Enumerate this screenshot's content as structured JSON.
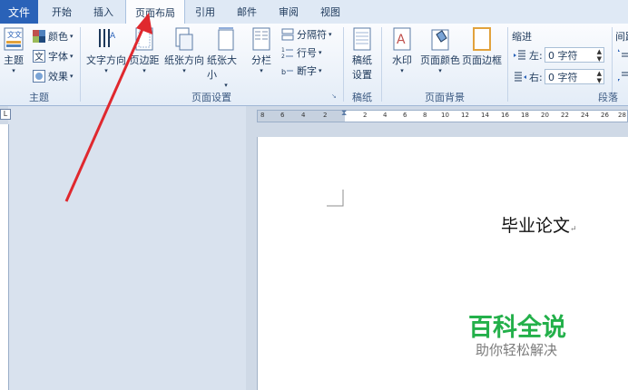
{
  "tabs": {
    "file": "文件",
    "home": "开始",
    "insert": "插入",
    "layout": "页面布局",
    "references": "引用",
    "mailings": "邮件",
    "review": "审阅",
    "view": "视图"
  },
  "theme": {
    "themes": "主题",
    "colors": "颜色",
    "fonts": "字体",
    "effects": "效果",
    "group": "主题"
  },
  "page_setup": {
    "text_direction": "文字方向",
    "margins": "页边距",
    "orientation": "纸张方向",
    "size": "纸张大小",
    "columns": "分栏",
    "breaks": "分隔符",
    "line_numbers": "行号",
    "hyphenation": "断字",
    "group": "页面设置"
  },
  "manuscript": {
    "label_line1": "稿纸",
    "label_line2": "设置",
    "group": "稿纸"
  },
  "page_background": {
    "watermark": "水印",
    "page_color": "页面颜色",
    "page_borders": "页面边框",
    "group": "页面背景"
  },
  "paragraph": {
    "indent": "缩进",
    "left": "左:",
    "right": "右:",
    "left_value": "0 字符",
    "right_value": "0 字符",
    "spacing": "间距",
    "group": "段落"
  },
  "ruler": {
    "corner": "L",
    "ticks": [
      "8",
      "6",
      "4",
      "2",
      "2",
      "4",
      "6",
      "8",
      "10",
      "12",
      "14",
      "16",
      "18",
      "20",
      "22",
      "24",
      "26",
      "28"
    ]
  },
  "document": {
    "title": "毕业论文",
    "para_mark": "↵"
  },
  "watermark": {
    "main": "百科全说",
    "sub": "助你轻松解决"
  },
  "colors": {
    "accent": "#2a62b8",
    "arrow": "#e0282e",
    "brand_green": "#23b04a"
  }
}
